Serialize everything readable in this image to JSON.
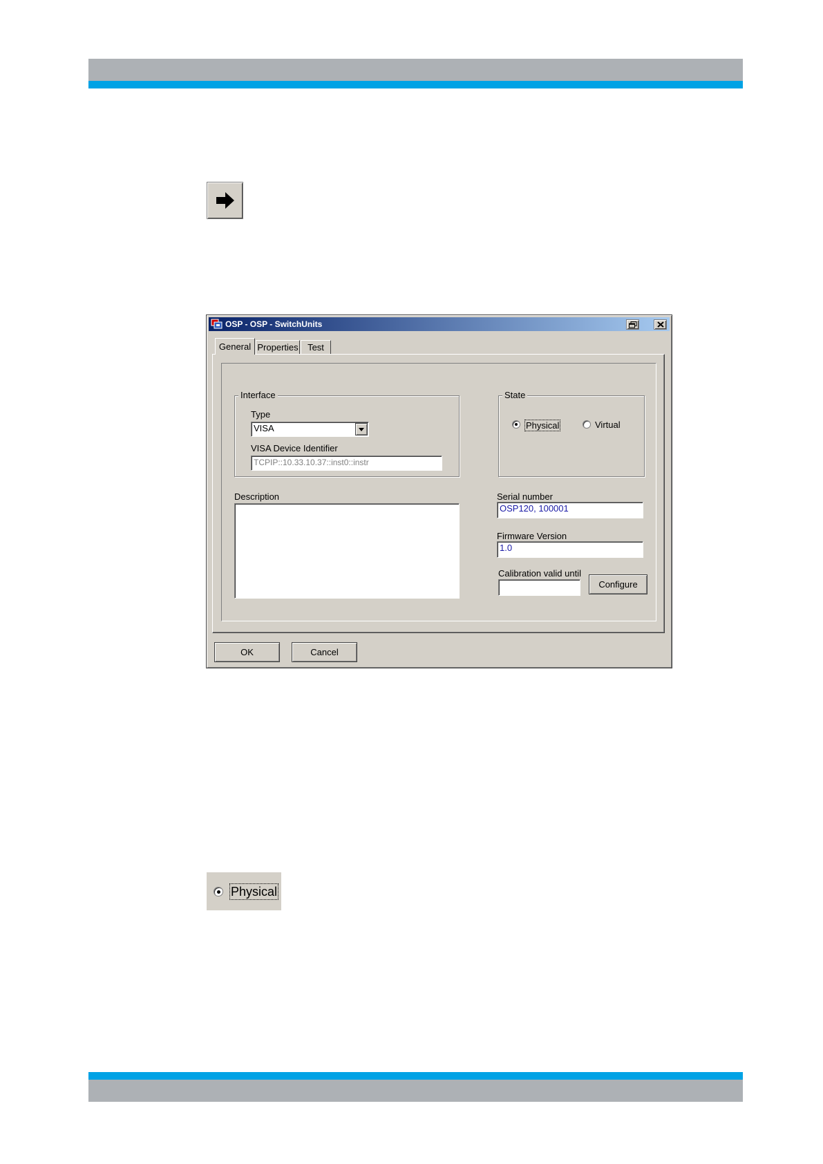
{
  "dialog": {
    "title": "OSP - OSP - SwitchUnits",
    "tabs": [
      {
        "label": "General"
      },
      {
        "label": "Properties"
      },
      {
        "label": "Test"
      }
    ],
    "interface": {
      "legend": "Interface",
      "type_label": "Type",
      "type_value": "VISA",
      "visa_label": "VISA Device Identifier",
      "visa_value": "TCPIP::10.33.10.37::inst0::instr"
    },
    "state": {
      "legend": "State",
      "physical_label": "Physical",
      "virtual_label": "Virtual"
    },
    "description_label": "Description",
    "serial_label": "Serial number",
    "serial_value": "OSP120, 100001",
    "firmware_label": "Firmware Version",
    "firmware_value": "1.0",
    "calibration_label": "Calibration valid until",
    "calibration_value": "",
    "configure_label": "Configure",
    "ok_label": "OK",
    "cancel_label": "Cancel"
  },
  "physical_example": {
    "label": "Physical"
  },
  "icons": [
    "arrow-right-icon",
    "app-icon",
    "restore-icon",
    "close-icon",
    "dropdown-arrow-icon"
  ],
  "colors": {
    "header_gray": "#adb1b5",
    "header_blue": "#00a2e5",
    "dialog_face": "#d4d0c8",
    "titlebar_start": "#0a246a",
    "field_text_blue": "#1a1aa6"
  }
}
